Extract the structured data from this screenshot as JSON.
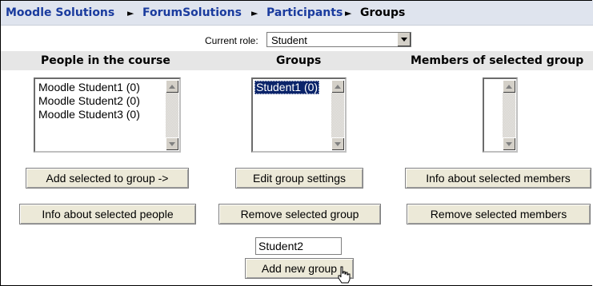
{
  "breadcrumb": {
    "items": [
      "Moodle Solutions",
      "ForumSolutions",
      "Participants",
      "Groups"
    ],
    "separator": "►"
  },
  "role": {
    "label": "Current role:",
    "value": "Student"
  },
  "columns": {
    "people": "People in the course",
    "groups": "Groups",
    "members": "Members of selected group"
  },
  "people_list": [
    "Moodle Student1 (0)",
    "Moodle Student2 (0)",
    "Moodle Student3 (0)"
  ],
  "groups_list": [
    "Student1 (0)"
  ],
  "members_list": [],
  "buttons": {
    "add_to_group": "Add selected to group ->",
    "edit_group": "Edit group settings",
    "info_members": "Info about selected members",
    "info_people": "Info about selected people",
    "remove_group": "Remove selected group",
    "remove_members": "Remove selected members",
    "add_new_group": "Add new group"
  },
  "new_group_input": {
    "value": "Student2"
  },
  "colors": {
    "link": "#1a3b9e",
    "breadcrumb_bg": "#dfe4ee",
    "header_bg": "#e6e6e6",
    "selection": "#0a246a"
  },
  "icons": [
    "select-arrow-icon",
    "scroll-up-icon",
    "scroll-down-icon",
    "hand-cursor-icon"
  ]
}
